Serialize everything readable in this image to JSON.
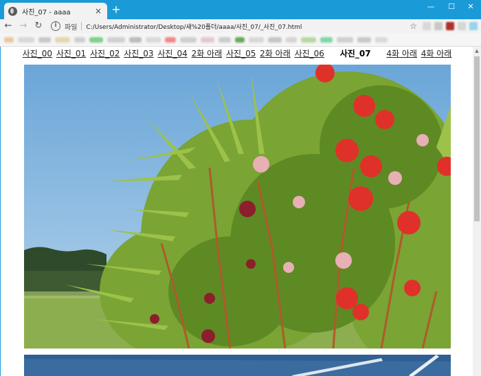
{
  "browser": {
    "tab_title": "사진_07 - aaaa",
    "tab_close": "×",
    "new_tab": "+",
    "window_controls": {
      "minimize": "—",
      "maximize": "☐",
      "close": "✕"
    },
    "nav": {
      "back": "←",
      "forward": "→",
      "reload": "↻"
    },
    "info_icon": "i",
    "scheme_label": "파일",
    "url": "C:/Users/Administrator/Desktop/새%20폴더/aaaa/사진_07/_사진_07.html",
    "star": "☆"
  },
  "page": {
    "links": [
      "사진_00",
      "사진_01",
      "사진_02",
      "사진_03",
      "사진_04",
      "2화 아래",
      "사진_05",
      "2화 아래",
      "사진_06"
    ],
    "current": "사진_07",
    "links_after": [
      "4화 아래",
      "4화 아래"
    ]
  },
  "colors": {
    "accent": "#1a9bd7",
    "sky": "#8bbde3",
    "leaf": "#6f9a2a",
    "flower": "#e0302a"
  }
}
